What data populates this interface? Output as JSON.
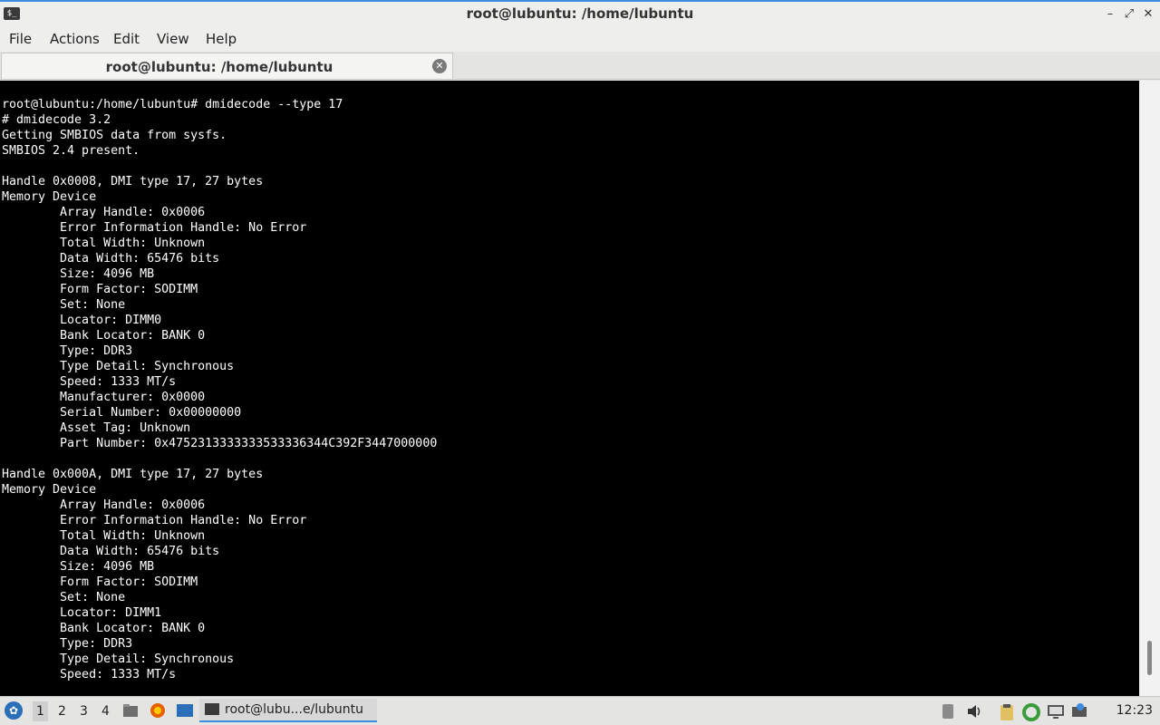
{
  "window": {
    "title": "root@lubuntu: /home/lubuntu",
    "app_icon": "$_"
  },
  "menubar": {
    "file": "File",
    "actions": "Actions",
    "edit": "Edit",
    "view": "View",
    "help": "Help"
  },
  "tab": {
    "label": "root@lubuntu: /home/lubuntu"
  },
  "terminal": {
    "lines": [
      "root@lubuntu:/home/lubuntu# dmidecode --type 17",
      "# dmidecode 3.2",
      "Getting SMBIOS data from sysfs.",
      "SMBIOS 2.4 present.",
      "",
      "Handle 0x0008, DMI type 17, 27 bytes",
      "Memory Device",
      "        Array Handle: 0x0006",
      "        Error Information Handle: No Error",
      "        Total Width: Unknown",
      "        Data Width: 65476 bits",
      "        Size: 4096 MB",
      "        Form Factor: SODIMM",
      "        Set: None",
      "        Locator: DIMM0",
      "        Bank Locator: BANK 0",
      "        Type: DDR3",
      "        Type Detail: Synchronous",
      "        Speed: 1333 MT/s",
      "        Manufacturer: 0x0000",
      "        Serial Number: 0x00000000",
      "        Asset Tag: Unknown",
      "        Part Number: 0x4752313333333533336344C392F3447000000",
      "",
      "Handle 0x000A, DMI type 17, 27 bytes",
      "Memory Device",
      "        Array Handle: 0x0006",
      "        Error Information Handle: No Error",
      "        Total Width: Unknown",
      "        Data Width: 65476 bits",
      "        Size: 4096 MB",
      "        Form Factor: SODIMM",
      "        Set: None",
      "        Locator: DIMM1",
      "        Bank Locator: BANK 0",
      "        Type: DDR3",
      "        Type Detail: Synchronous",
      "        Speed: 1333 MT/s"
    ]
  },
  "taskbar": {
    "workspaces": [
      "1",
      "2",
      "3",
      "4"
    ],
    "task_label": "root@lubu...e/lubuntu",
    "clock": "12:23"
  }
}
